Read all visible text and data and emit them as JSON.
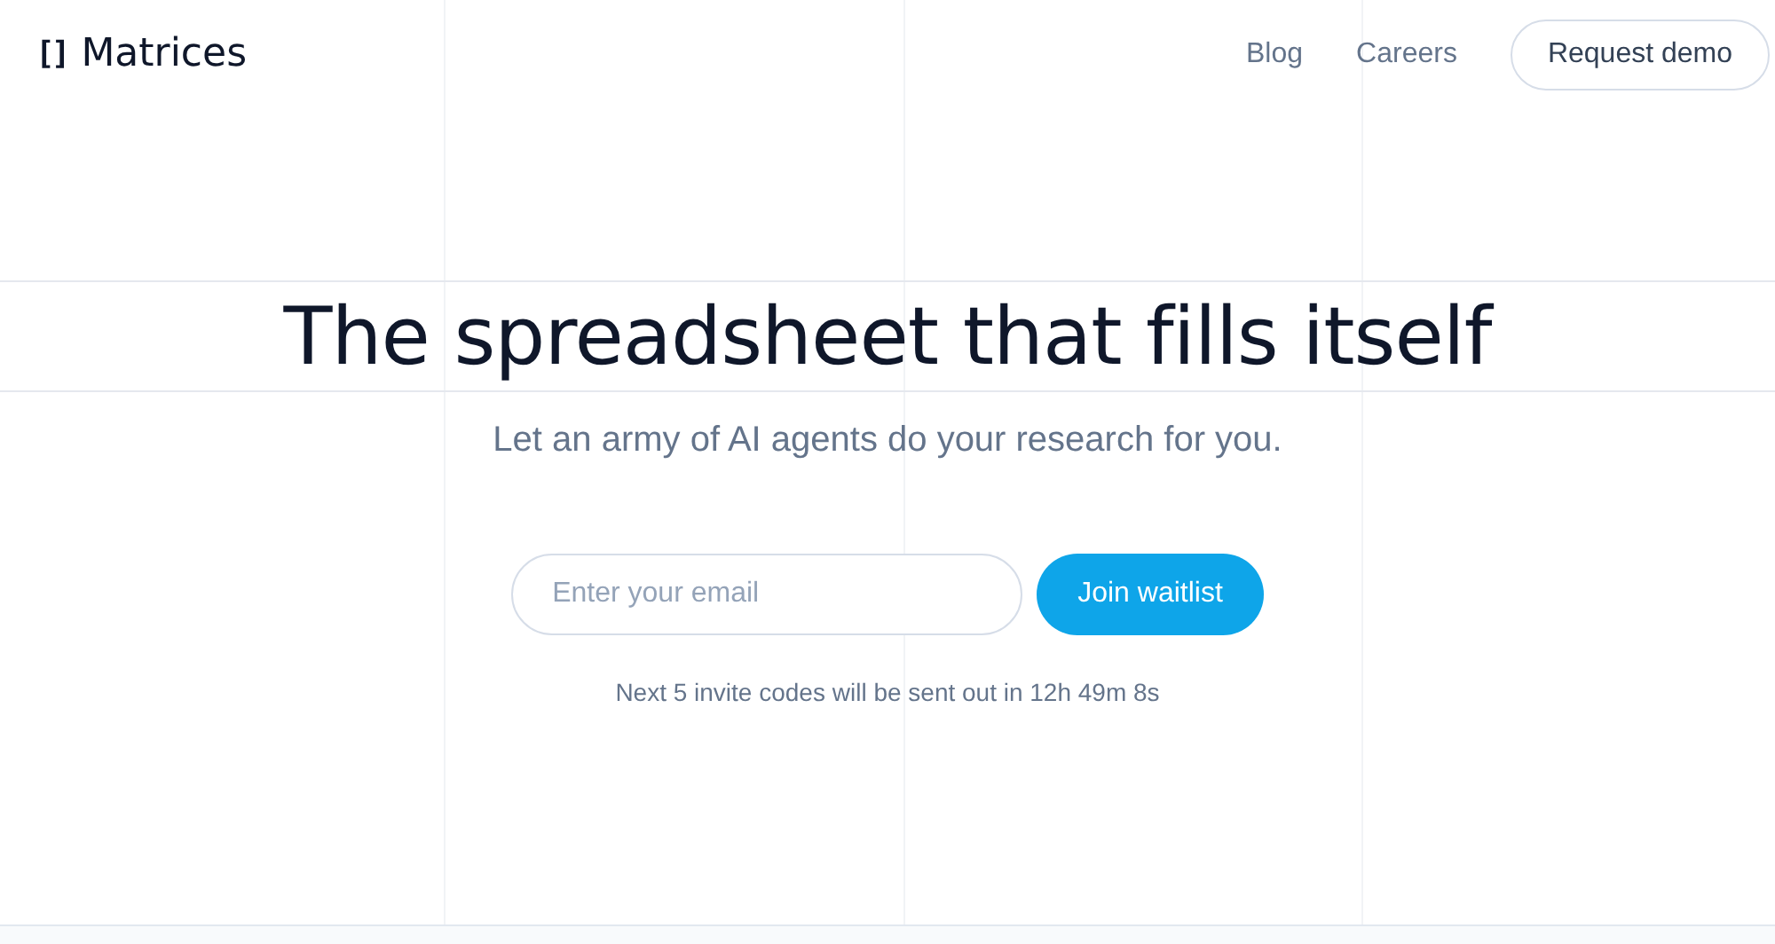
{
  "header": {
    "logo_mark": "[]",
    "logo_text": "Matrices",
    "nav": [
      "Blog",
      "Careers"
    ],
    "cta": "Request demo"
  },
  "hero": {
    "title": "The spreadsheet that fills itself",
    "subtitle": "Let an army of AI agents do your research for you.",
    "email": {
      "placeholder": "Enter your email"
    },
    "button": "Join waitlist",
    "note": "Next 5 invite codes will be sent out in 12h 49m 8s"
  }
}
